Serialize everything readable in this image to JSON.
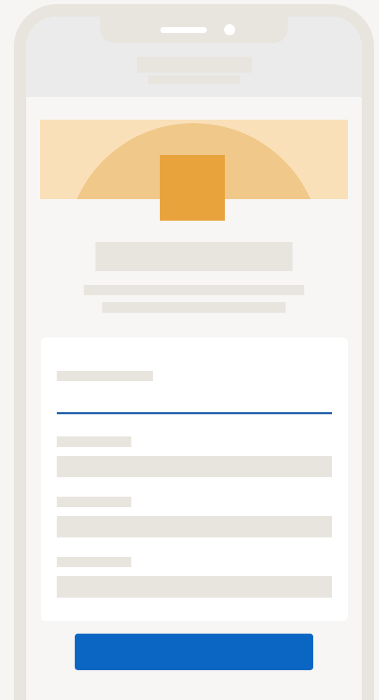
{
  "form": {
    "fields": [
      {
        "kind": "underline",
        "focused": true
      },
      {
        "kind": "box",
        "focused": false
      },
      {
        "kind": "box",
        "focused": false
      },
      {
        "kind": "box",
        "focused": false
      }
    ]
  }
}
